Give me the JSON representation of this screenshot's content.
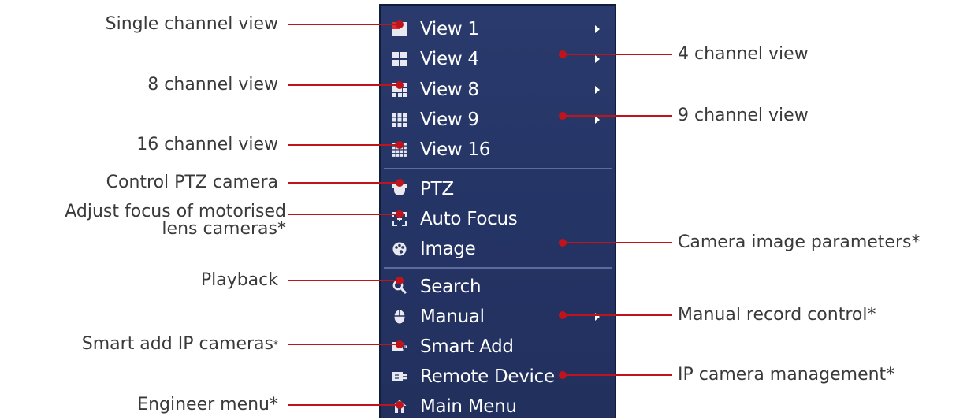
{
  "menu": {
    "items": [
      {
        "label": "View 1",
        "icon": "single-view-icon",
        "arrow": true
      },
      {
        "label": "View 4",
        "icon": "quad-view-icon",
        "arrow": true
      },
      {
        "label": "View 8",
        "icon": "eight-view-icon",
        "arrow": true
      },
      {
        "label": "View 9",
        "icon": "nine-view-icon",
        "arrow": true
      },
      {
        "label": "View 16",
        "icon": "sixteen-view-icon",
        "arrow": false
      },
      {
        "label": "PTZ",
        "icon": "ptz-camera-icon",
        "arrow": false
      },
      {
        "label": "Auto Focus",
        "icon": "auto-focus-icon",
        "arrow": false
      },
      {
        "label": "Image",
        "icon": "image-palette-icon",
        "arrow": false
      },
      {
        "label": "Search",
        "icon": "search-icon",
        "arrow": false
      },
      {
        "label": "Manual",
        "icon": "mouse-icon",
        "arrow": true
      },
      {
        "label": "Smart Add",
        "icon": "smart-add-icon",
        "arrow": false
      },
      {
        "label": "Remote Device",
        "icon": "remote-device-icon",
        "arrow": false
      },
      {
        "label": "Main Menu",
        "icon": "home-icon",
        "arrow": false
      }
    ]
  },
  "callouts_left": {
    "single": "Single channel view",
    "eight": "8 channel view",
    "sixteen": "16 channel view",
    "ptz": "Control PTZ camera",
    "focus_line1": "Adjust focus of motorised",
    "focus_line2": "lens cameras*",
    "playback": "Playback",
    "smart_add_text": "Smart add IP cameras",
    "smart_add_star": "*",
    "engineer": "Engineer menu*"
  },
  "callouts_right": {
    "four": "4 channel view",
    "nine": "9 channel view",
    "image": "Camera image parameters*",
    "manual": "Manual record control*",
    "ip": "IP camera management*"
  },
  "colors": {
    "menu_bg": "#243465",
    "callout_line": "#c0141c",
    "callout_text": "#3a3a3a"
  }
}
